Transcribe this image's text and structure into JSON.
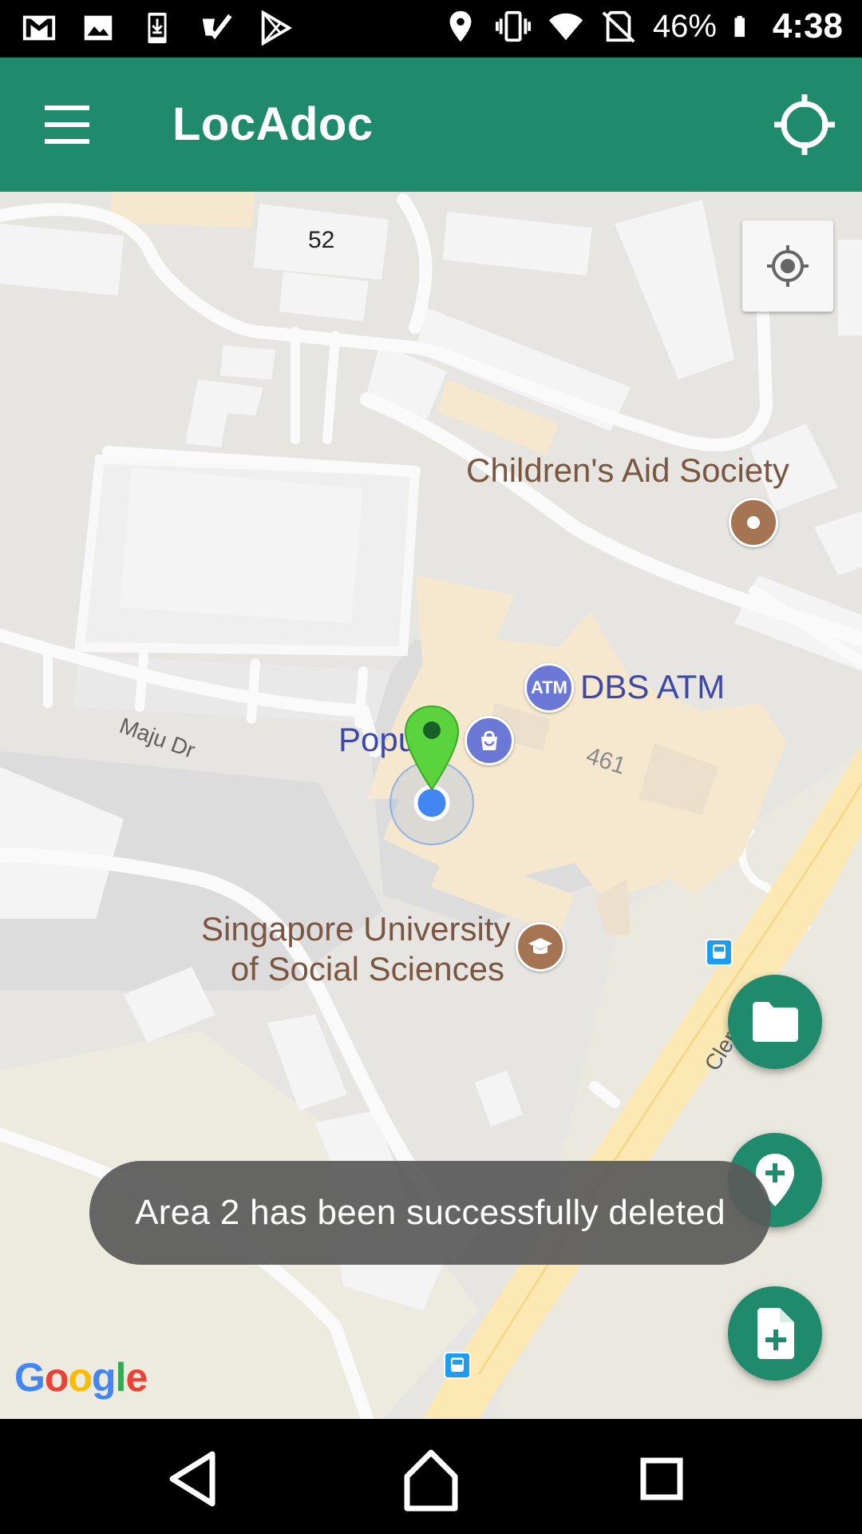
{
  "status_bar": {
    "battery": "46%",
    "time": "4:38"
  },
  "app_bar": {
    "title": "LocAdoc"
  },
  "map": {
    "labels": {
      "childrens_aid": "Children's Aid Society",
      "dbs_atm": "DBS ATM",
      "popular": "Popu",
      "suss_line1": "Singapore University",
      "suss_line2": "of Social Sciences",
      "maju_dr": "Maju Dr",
      "clementi": "Cler",
      "building_52": "52",
      "building_461": "461",
      "atm_badge": "ATM"
    },
    "attribution": {
      "g1": "G",
      "o1": "o",
      "o2": "o",
      "g2": "g",
      "l": "l",
      "e": "e"
    }
  },
  "toast": {
    "message": "Area 2 has been successfully deleted"
  },
  "colors": {
    "primary": "#1f8a6c",
    "map_bg": "#e6e5e1",
    "marker_green": "#4cd137",
    "location_blue": "#4285f4"
  },
  "icons": {
    "menu": "hamburger-menu-icon",
    "target": "crosshair-icon",
    "folder": "folder-icon",
    "add_location": "add-location-icon",
    "add_file": "note-add-icon"
  }
}
